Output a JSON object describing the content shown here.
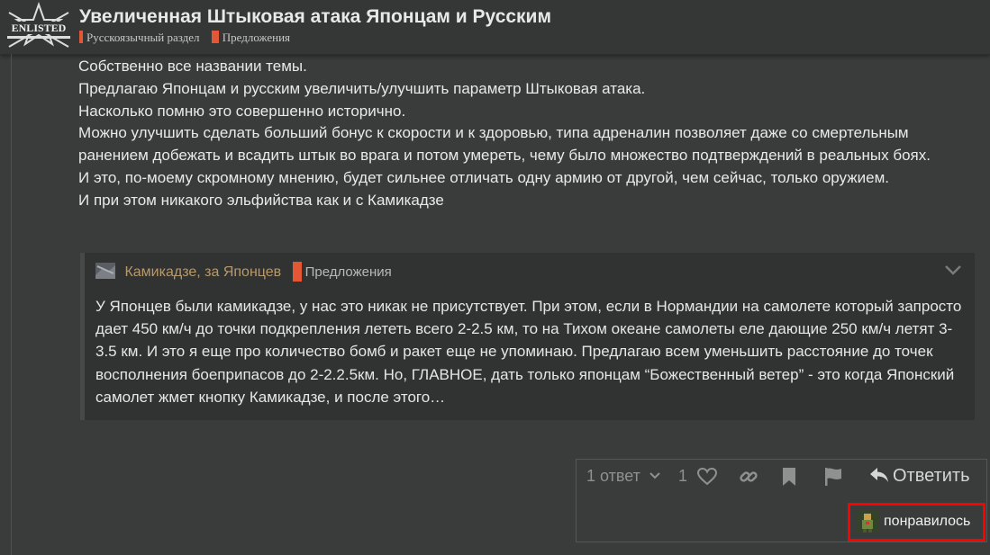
{
  "header": {
    "logo_text": "ENLISTED",
    "topic_title": "Увеличенная Штыковая атака Японцам и Русским",
    "categories": [
      {
        "name": "Русскоязычный раздел",
        "color": "#e45735"
      },
      {
        "name": "Предложения",
        "color": "#e45735"
      }
    ]
  },
  "post": {
    "paragraphs": [
      "Собственно все названии темы.",
      "Предлагаю Японцам и русским увеличить/улучшить параметр Штыковая атака.",
      "Насколько помню это совершенно исторично.",
      "Можно улучшить сделать больший бонус к скорости и к здоровью, типа адреналин позволяет даже со смертельным ранением добежать и всадить штык во врага и потом умереть, чему было множество подтверждений в реальных боях.",
      "И это, по-моему скромному мнению, будет сильнее отличать одну армию от другой, чем сейчас, только оружием.",
      "И при этом никакого эльфийства как и с Камикадзе"
    ]
  },
  "quote": {
    "topic": "Камикадзе, за Японцев",
    "category": "Предложения",
    "category_color": "#e45735",
    "text": "У Японцев были камикадзе, у нас это никак не присутствует. При этом, если в Нормандии на самолете который запросто дает 450 км/ч до точки подкрепления лететь всего 2-2.5 км, то на Тихом океане самолеты еле дающие 250 км/ч летят 3-3.5 км. И это я еще про количество бомб и ракет еще не упоминаю. Предлагаю всем уменьшить расстояние до точек восполнения боеприпасов до 2-2.2.5км. Но, ГЛАВНОЕ, дать только японцам “Божественный ветер” - это когда Японский самолет жмет кнопку Камикадзе, и после этого…"
  },
  "actions": {
    "replies_label": "1 ответ",
    "like_count": "1",
    "reply_label": "Ответить",
    "icons": [
      "chevron-down-icon",
      "heart-icon",
      "link-icon",
      "bookmark-icon",
      "flag-icon",
      "reply-arrow-icon"
    ]
  },
  "liked_chip": {
    "label": "понравилось"
  }
}
